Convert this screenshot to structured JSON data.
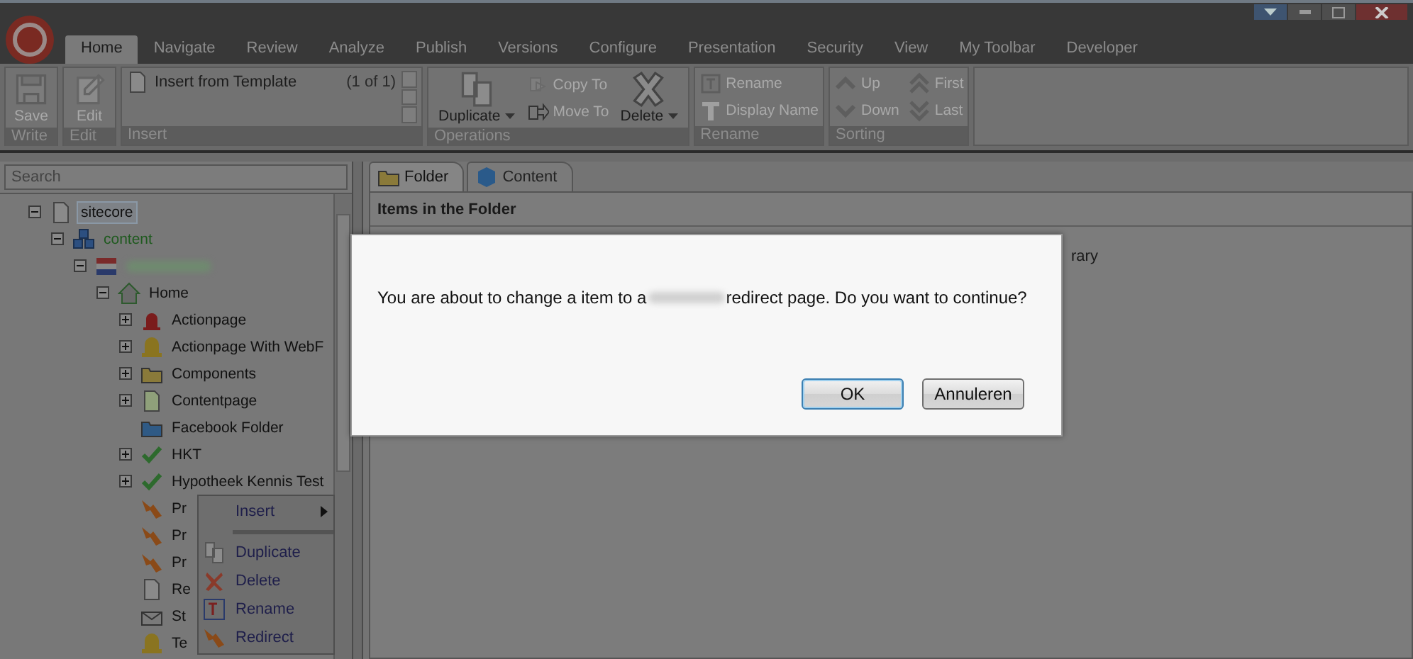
{
  "ribbon_tabs": [
    {
      "label": "Home",
      "selected": true
    },
    {
      "label": "Navigate",
      "selected": false
    },
    {
      "label": "Review",
      "selected": false
    },
    {
      "label": "Analyze",
      "selected": false
    },
    {
      "label": "Publish",
      "selected": false
    },
    {
      "label": "Versions",
      "selected": false
    },
    {
      "label": "Configure",
      "selected": false
    },
    {
      "label": "Presentation",
      "selected": false
    },
    {
      "label": "Security",
      "selected": false
    },
    {
      "label": "View",
      "selected": false
    },
    {
      "label": "My Toolbar",
      "selected": false
    },
    {
      "label": "Developer",
      "selected": false
    }
  ],
  "ribbon_groups": [
    {
      "label": "Write",
      "kind": "large",
      "buttons": [
        {
          "label": "Save",
          "disabled": true
        }
      ]
    },
    {
      "label": "Edit",
      "kind": "large",
      "buttons": [
        {
          "label": "Edit",
          "disabled": true
        }
      ]
    },
    {
      "label": "Insert",
      "kind": "gallery",
      "item": "Insert from Template",
      "count": "(1 of 1)"
    },
    {
      "label": "Operations",
      "kind": "operations",
      "buttons": [
        {
          "label": "Duplicate",
          "dropdown": true,
          "disabled": false
        },
        {
          "label": "Copy To",
          "disabled": true
        },
        {
          "label": "Move To",
          "disabled": true
        },
        {
          "label": "Delete",
          "dropdown": true,
          "disabled": false
        }
      ]
    },
    {
      "label": "Rename",
      "kind": "small",
      "buttons": [
        {
          "label": "Rename",
          "disabled": true
        },
        {
          "label": "Display Name",
          "disabled": true
        }
      ]
    },
    {
      "label": "Sorting",
      "kind": "small",
      "buttons": [
        {
          "label": "Up",
          "disabled": true
        },
        {
          "label": "Down",
          "disabled": true
        },
        {
          "label": "First",
          "disabled": true
        },
        {
          "label": "Last",
          "disabled": true
        }
      ]
    }
  ],
  "search": {
    "placeholder": "Search"
  },
  "tree": [
    {
      "label": "sitecore",
      "kind": "page",
      "expanded": true,
      "selected": true,
      "children": [
        {
          "label": "content",
          "kind": "cubes",
          "expanded": true,
          "selected": false,
          "green": true,
          "children": [
            {
              "kind": "flag",
              "redacted": true,
              "expanded": true,
              "selected": false,
              "children": [
                {
                  "label": "Home",
                  "kind": "house",
                  "expanded": true,
                  "selected": false,
                  "children": [
                    {
                      "label": "Actionpage",
                      "kind": "alarm",
                      "expanded": false,
                      "selected": false
                    },
                    {
                      "label": "Actionpage With WebF",
                      "kind": "bell",
                      "expanded": false,
                      "selected": false
                    },
                    {
                      "label": "Components",
                      "kind": "folder",
                      "expanded": false,
                      "selected": false
                    },
                    {
                      "label": "Contentpage",
                      "kind": "doc",
                      "expanded": false,
                      "selected": false
                    },
                    {
                      "label": "Facebook Folder",
                      "kind": "bluefolder",
                      "selected": false
                    },
                    {
                      "label": "HKT",
                      "kind": "check",
                      "expanded": false,
                      "selected": false
                    },
                    {
                      "label": "Hypotheek Kennis Test",
                      "kind": "check",
                      "expanded": false,
                      "selected": false
                    },
                    {
                      "label": "Pr",
                      "kind": "redirect",
                      "selected": false
                    },
                    {
                      "label": "Pr",
                      "kind": "redirect",
                      "selected": false
                    },
                    {
                      "label": "Pr",
                      "kind": "redirect",
                      "selected": false
                    },
                    {
                      "label": "Re",
                      "kind": "page",
                      "selected": false
                    },
                    {
                      "label": "St",
                      "kind": "mail",
                      "selected": false
                    },
                    {
                      "label": "Te",
                      "kind": "bell",
                      "selected": false
                    }
                  ]
                }
              ]
            }
          ]
        }
      ]
    }
  ],
  "content_tabs": [
    {
      "label": "Folder",
      "kind": "folder",
      "selected": true
    },
    {
      "label": "Content",
      "kind": "cube",
      "selected": false
    }
  ],
  "content_heading": "Items in the Folder",
  "content_fragment": "rary",
  "context_menu": [
    {
      "label": "Insert",
      "kind": "submenu"
    },
    {
      "kind": "separator"
    },
    {
      "label": "Duplicate",
      "kind": "duplicate"
    },
    {
      "label": "Delete",
      "kind": "delete"
    },
    {
      "label": "Rename",
      "kind": "rename"
    },
    {
      "label": "Redirect",
      "kind": "redirect"
    }
  ],
  "dialog": {
    "message_start": "You are about to change a item to a",
    "message_end": "redirect page. Do you want to continue?",
    "buttons": [
      {
        "label": "OK",
        "focused": true
      },
      {
        "label": "Annuleren",
        "focused": false
      }
    ]
  }
}
